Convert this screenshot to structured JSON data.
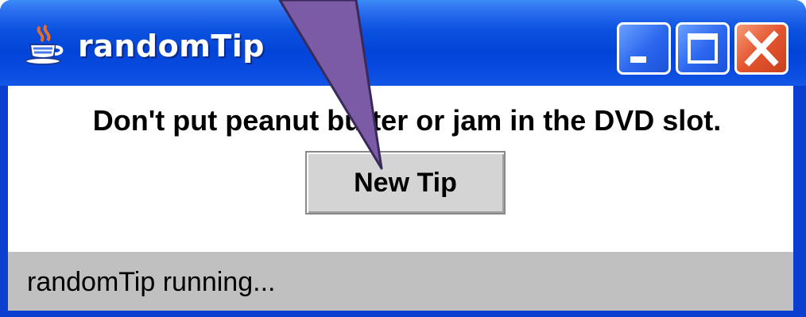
{
  "window": {
    "title": "randomTip",
    "title_icon": "java-coffee-cup-icon",
    "controls": {
      "minimize_icon": "minimize-icon",
      "maximize_icon": "maximize-icon",
      "close_icon": "close-icon"
    }
  },
  "content": {
    "tip": "Don't put peanut butter or jam in the DVD slot.",
    "button_label": "New Tip"
  },
  "status": {
    "text": "randomTip running..."
  },
  "colors": {
    "titlebar": "#0a4ce0",
    "close_button": "#e4552e",
    "callout": "#7b5aa6",
    "statusbar": "#c0c0c0"
  }
}
